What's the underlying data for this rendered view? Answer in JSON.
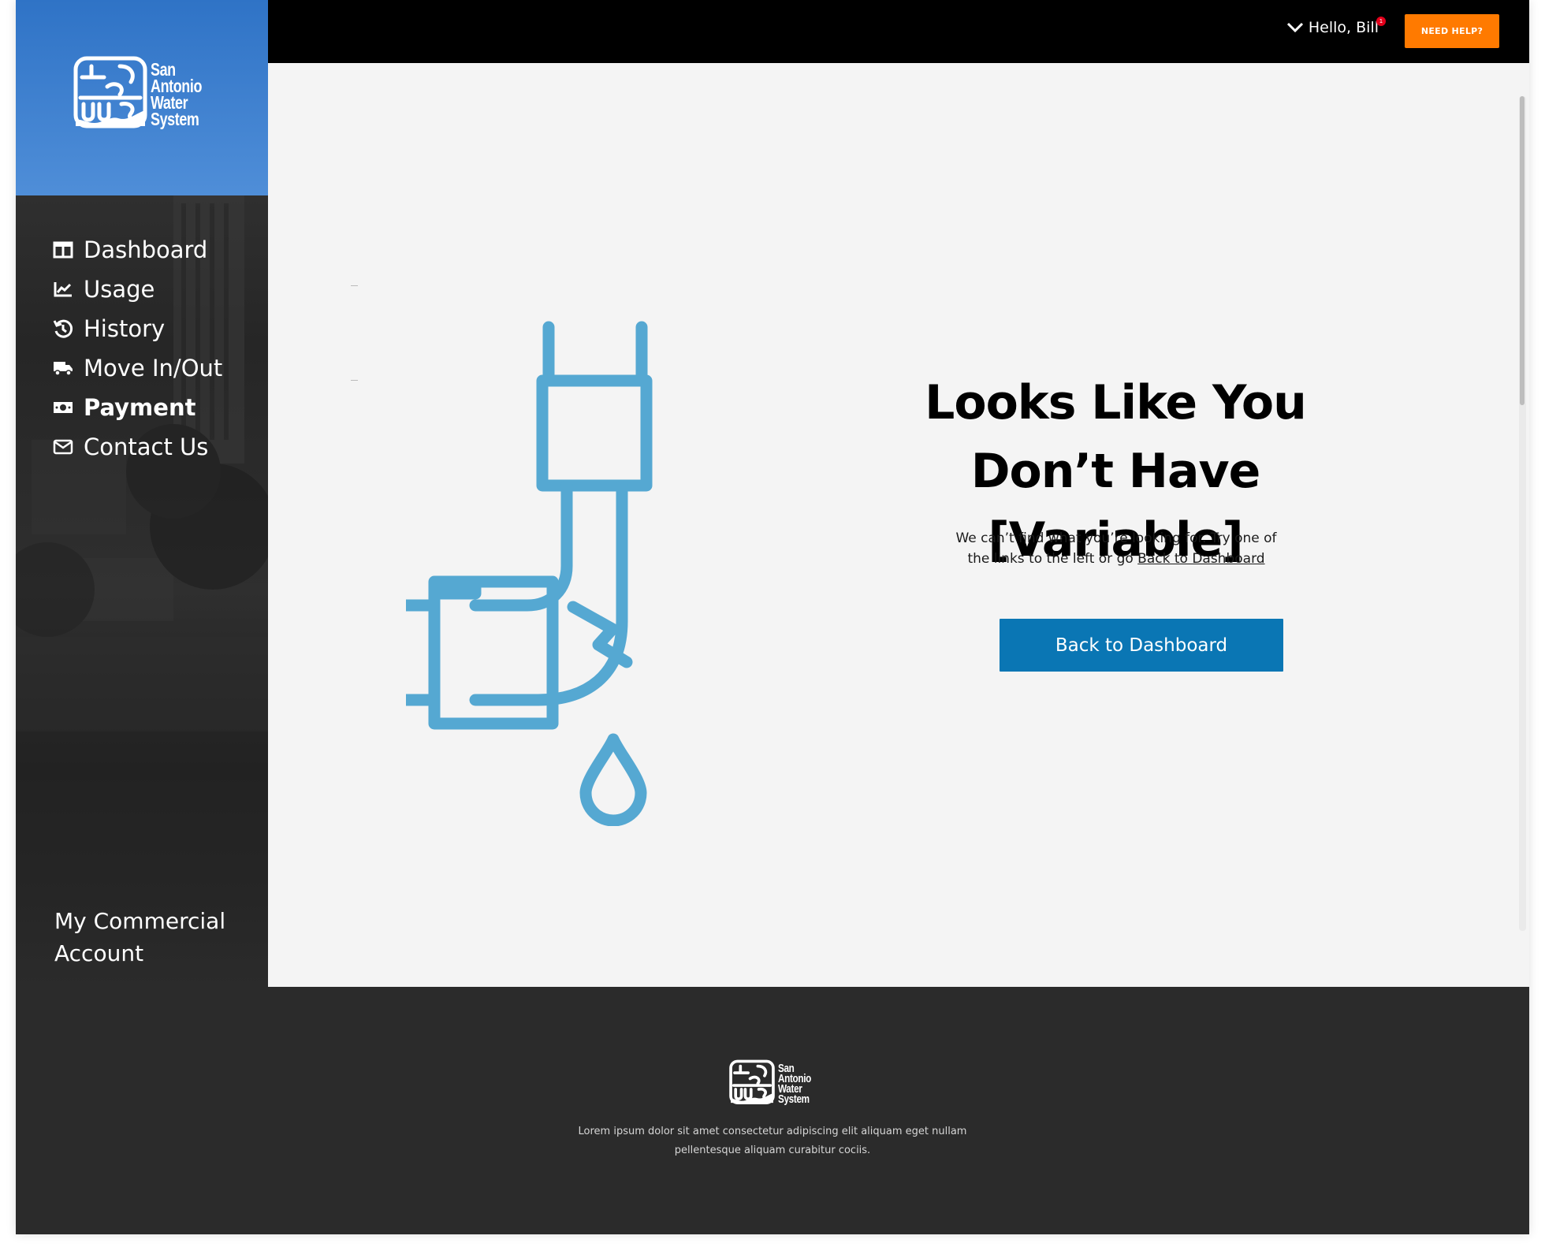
{
  "brand": {
    "name_lines": [
      "San",
      "Antonio",
      "Water",
      "System"
    ],
    "logo_color": "#ffffff",
    "header_gradient": [
      "#2f73c6",
      "#4f8ed8"
    ]
  },
  "sidebar": {
    "items": [
      {
        "label": "Dashboard",
        "icon": "dashboard-icon",
        "active": false
      },
      {
        "label": "Usage",
        "icon": "chart-line-icon",
        "active": false
      },
      {
        "label": "History",
        "icon": "history-icon",
        "active": false
      },
      {
        "label": "Move In/Out",
        "icon": "truck-icon",
        "active": false
      },
      {
        "label": "Payment",
        "icon": "money-bill-icon",
        "active": true
      },
      {
        "label": "Contact Us",
        "icon": "envelope-icon",
        "active": false
      }
    ],
    "account_label": "My Commercial Account"
  },
  "header": {
    "greeting": "Hello, Bill",
    "notification_count": "1",
    "help_button": "NEED HELP?",
    "help_color": "#ff7a00"
  },
  "main": {
    "illustration": "broken-pipe-icon",
    "illustration_color": "#55a8d2",
    "headline": "Looks Like You Don’t Have [Variable]",
    "subtext_prefix": "We can’t find what you’re looking for. Try one of the links to the left or go ",
    "subtext_link": "Back to Dashboard",
    "cta_button": "Back to Dashboard",
    "cta_color": "#0a76b4"
  },
  "footer": {
    "text": "Lorem ipsum dolor sit amet consectetur adipiscing elit aliquam eget nullam pellentesque aliquam curabitur cociis."
  }
}
